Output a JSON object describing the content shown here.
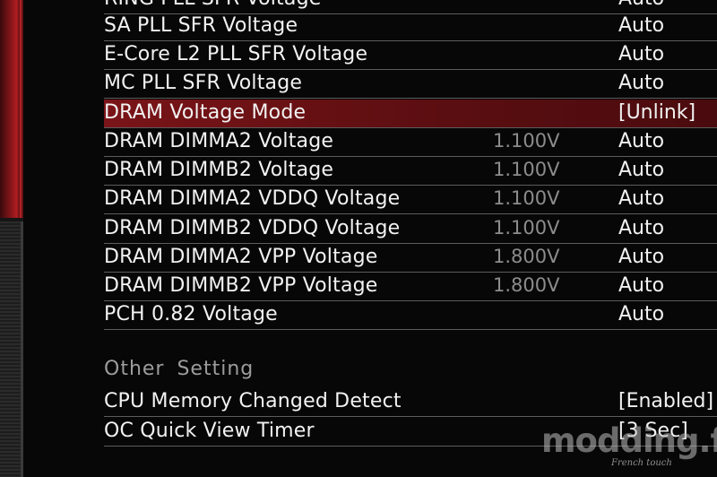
{
  "voltage_rows": [
    {
      "label": "RING PLL SFR Voltage",
      "current": "",
      "value": "Auto"
    },
    {
      "label": "SA PLL SFR Voltage",
      "current": "",
      "value": "Auto"
    },
    {
      "label": "E-Core L2 PLL SFR Voltage",
      "current": "",
      "value": "Auto"
    },
    {
      "label": "MC PLL SFR Voltage",
      "current": "",
      "value": "Auto"
    },
    {
      "label": "DRAM Voltage Mode",
      "current": "",
      "value": "[Unlink]"
    },
    {
      "label": "DRAM DIMMA2 Voltage",
      "current": "1.100V",
      "value": "Auto"
    },
    {
      "label": "DRAM DIMMB2 Voltage",
      "current": "1.100V",
      "value": "Auto"
    },
    {
      "label": "DRAM DIMMA2 VDDQ Voltage",
      "current": "1.100V",
      "value": "Auto"
    },
    {
      "label": "DRAM DIMMB2 VDDQ Voltage",
      "current": "1.100V",
      "value": "Auto"
    },
    {
      "label": "DRAM DIMMA2 VPP Voltage",
      "current": "1.800V",
      "value": "Auto"
    },
    {
      "label": "DRAM DIMMB2 VPP Voltage",
      "current": "1.800V",
      "value": "Auto"
    },
    {
      "label": "PCH 0.82 Voltage",
      "current": "",
      "value": "Auto"
    }
  ],
  "other_setting": {
    "header": "Other Setting",
    "rows": [
      {
        "label": "CPU Memory Changed Detect",
        "value": "[Enabled]"
      },
      {
        "label": "OC Quick View Timer",
        "value": "[3 Sec]"
      }
    ]
  },
  "watermark": {
    "logo": "modding.fr",
    "tagline": "French touch"
  },
  "colors": {
    "background": "#070707",
    "selected_row": "#7a1418",
    "text": "#f2f2f2",
    "current_value_text": "#8c8c8c",
    "section_header_text": "#9c9c9c",
    "side_accent": "#b01d22"
  }
}
